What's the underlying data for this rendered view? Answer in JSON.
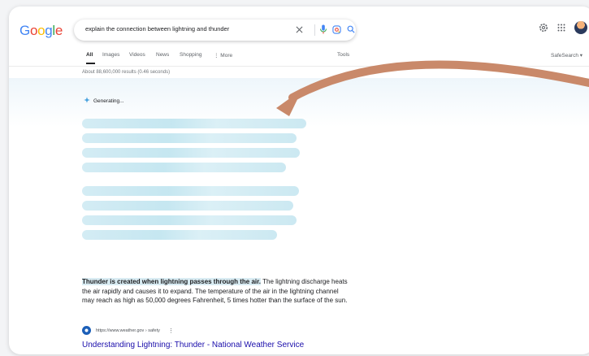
{
  "header": {
    "logo": "Google",
    "logo_colors": [
      "#4285F4",
      "#EA4335",
      "#FBBC05",
      "#4285F4",
      "#34A853",
      "#EA4335"
    ],
    "search_query": "explain the connection between lightning and thunder",
    "icons": [
      "clear-icon",
      "mic-icon",
      "lens-icon",
      "search-icon",
      "settings-icon",
      "apps-icon",
      "avatar"
    ]
  },
  "tabs": [
    "All",
    "Images",
    "Videos",
    "News",
    "Shopping",
    "⋮ More"
  ],
  "tools_label": "Tools",
  "safesearch_label": "SafeSearch ▾",
  "results_count": "About 88,600,000 results (0.46 seconds)",
  "ai_overview": {
    "status": "Generating..."
  },
  "snippet": {
    "bold_text": "Thunder is created when lightning passes through the air.",
    "rest_text": " The lightning discharge heats the air rapidly and causes it to expand. The temperature of the air in the lightning channel may reach as high as 50,000 degrees Fahrenheit, 5 times hotter than the surface of the sun.",
    "source_url": "https://www.weather.gov › safety",
    "title": "Understanding Lightning: Thunder - National Weather Service"
  },
  "colors": {
    "arrow": "#c9896a",
    "link": "#1a0dab",
    "shimmer": "#c6e6f0"
  }
}
